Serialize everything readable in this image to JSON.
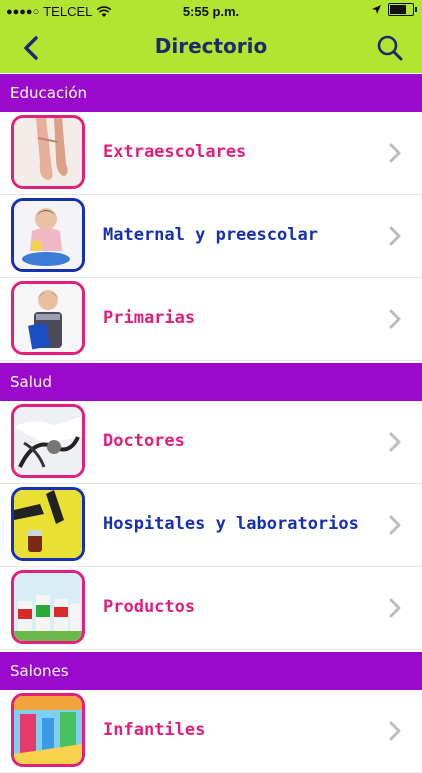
{
  "status_bar": {
    "carrier": "TELCEL",
    "signal_dots": "●●●●○",
    "time": "5:55 p.m."
  },
  "nav": {
    "title": "Directorio"
  },
  "colors": {
    "topbar": "#b2e532",
    "section": "#9b0acc",
    "pink": "#e0207a",
    "blue": "#1630b0",
    "chevron": "#bdbdbd"
  },
  "sections": [
    {
      "title": "Educación"
    },
    {
      "title": "Salud"
    },
    {
      "title": "Salones"
    }
  ],
  "items": [
    {
      "label": "Extraescolares",
      "color": "pink",
      "icon": "ballet-shoes-image"
    },
    {
      "label": "Maternal y preescolar",
      "color": "blue",
      "icon": "toddler-image"
    },
    {
      "label": "Primarias",
      "color": "pink",
      "icon": "schoolboy-image"
    },
    {
      "label": "Doctores",
      "color": "pink",
      "icon": "stethoscope-image"
    },
    {
      "label": "Hospitales y laboratorios",
      "color": "blue",
      "icon": "lab-test-image"
    },
    {
      "label": "Productos",
      "color": "pink",
      "icon": "products-image"
    },
    {
      "label": "Infantiles",
      "color": "pink",
      "icon": "playground-image"
    }
  ]
}
